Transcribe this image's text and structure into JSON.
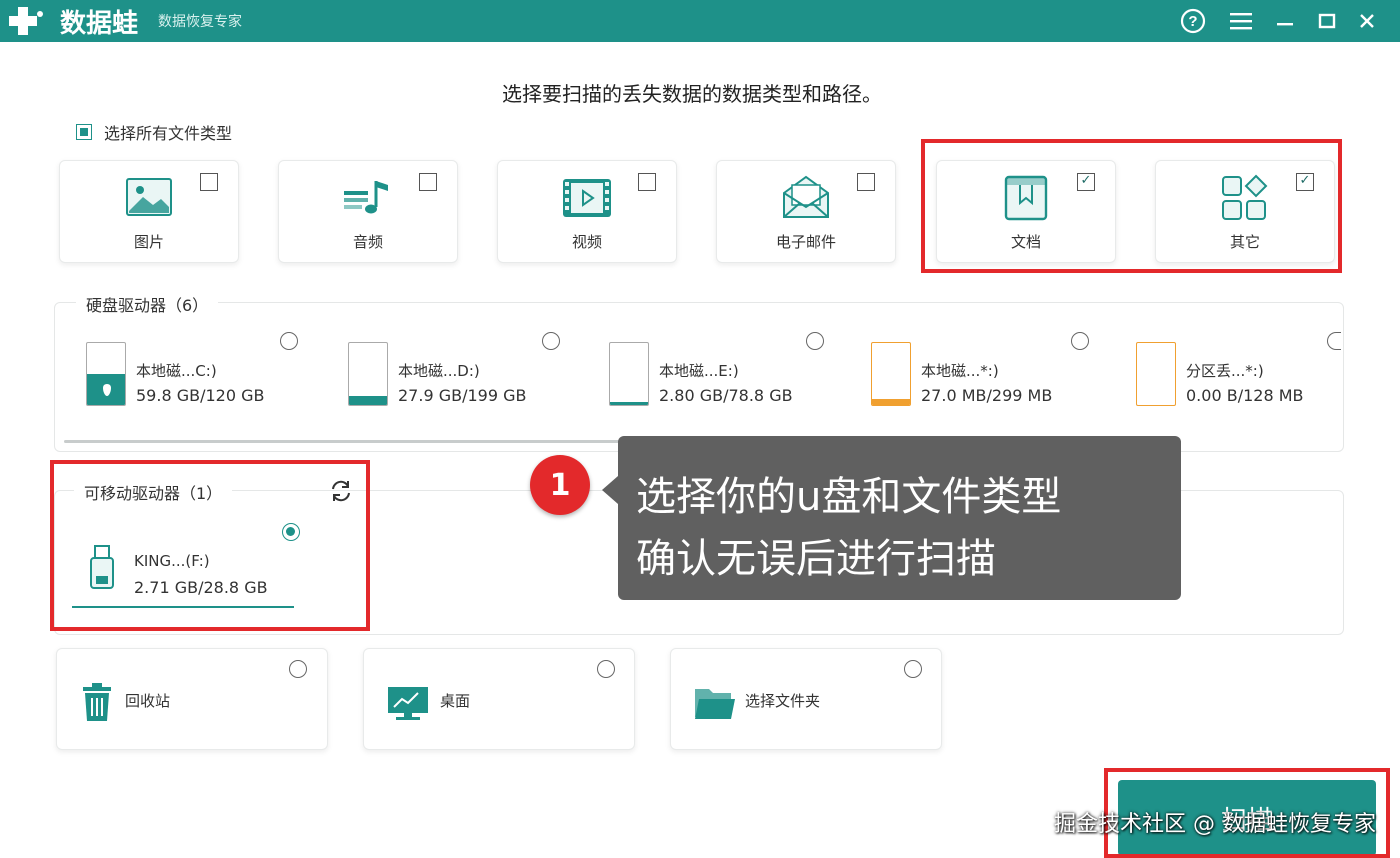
{
  "app": {
    "name": "数据蛙",
    "subtitle": "数据恢复专家"
  },
  "title_icons": [
    "help-icon",
    "menu-icon",
    "minimize-icon",
    "maximize-icon",
    "close-icon"
  ],
  "headline": "选择要扫描的丢失数据的数据类型和路径。",
  "select_all": {
    "label": "选择所有文件类型",
    "checked": true
  },
  "file_types": [
    {
      "label": "图片",
      "icon": "picture-icon",
      "checked": false
    },
    {
      "label": "音频",
      "icon": "audio-icon",
      "checked": false
    },
    {
      "label": "视频",
      "icon": "video-icon",
      "checked": false
    },
    {
      "label": "电子邮件",
      "icon": "email-icon",
      "checked": false
    },
    {
      "label": "文档",
      "icon": "document-icon",
      "checked": true
    },
    {
      "label": "其它",
      "icon": "other-icon",
      "checked": true
    }
  ],
  "hard_drives": {
    "title": "硬盘驱动器（6）",
    "items": [
      {
        "name": "本地磁...C:)",
        "size": "59.8 GB/120 GB",
        "used_fraction": 0.5,
        "color": "#1e9189"
      },
      {
        "name": "本地磁...D:)",
        "size": "27.9 GB/199 GB",
        "used_fraction": 0.14,
        "color": "#1e9189"
      },
      {
        "name": "本地磁...E:)",
        "size": "2.80 GB/78.8 GB",
        "used_fraction": 0.04,
        "color": "#1e9189"
      },
      {
        "name": "本地磁...*:)",
        "size": "27.0 MB/299 MB",
        "used_fraction": 0.09,
        "color": "#f0a030"
      },
      {
        "name": "分区丢...*:)",
        "size": "0.00  B/128 MB",
        "used_fraction": 0.0,
        "color": "#f0a030"
      }
    ]
  },
  "removable": {
    "title": "可移动驱动器（1）",
    "items": [
      {
        "name": "KING...(F:)",
        "size": "2.71 GB/28.8 GB",
        "selected": true
      }
    ]
  },
  "locations": [
    {
      "label": "回收站",
      "icon": "recycle-bin-icon"
    },
    {
      "label": "桌面",
      "icon": "desktop-icon"
    },
    {
      "label": "选择文件夹",
      "icon": "folder-icon"
    }
  ],
  "tooltip": {
    "step": "1",
    "line1": "选择你的u盘和文件类型",
    "line2": "确认无误后进行扫描"
  },
  "scan_button": "扫描",
  "watermark": "掘金技术社区 @ 数据蛙恢复专家",
  "colors": {
    "brand": "#1e9189",
    "highlight": "#e3292b"
  }
}
